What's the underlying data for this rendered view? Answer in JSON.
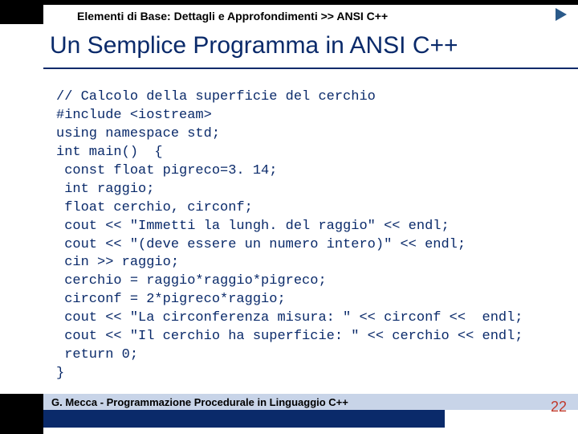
{
  "breadcrumb": "Elementi di Base: Dettagli e Approfondimenti >> ANSI C++",
  "title": "Un Semplice Programma in ANSI C++",
  "code": {
    "l1": "// Calcolo della superficie del cerchio",
    "l2": "#include <iostream>",
    "l3": "using namespace std;",
    "l4": "int main()  {",
    "l5": " const float pigreco=3. 14;",
    "l6": " int raggio;",
    "l7": " float cerchio, circonf;",
    "l8": " cout << \"Immetti la lungh. del raggio\" << endl;",
    "l9": " cout << \"(deve essere un numero intero)\" << endl;",
    "l10": " cin >> raggio;",
    "l11": " cerchio = raggio*raggio*pigreco;",
    "l12": " circonf = 2*pigreco*raggio;",
    "l13": " cout << \"La circonferenza misura: \" << circonf <<  endl;",
    "l14": " cout << \"Il cerchio ha superficie: \" << cerchio << endl;",
    "l15": " return 0;",
    "l16": "}"
  },
  "footer": "G. Mecca - Programmazione Procedurale in Linguaggio C++",
  "page": "22"
}
